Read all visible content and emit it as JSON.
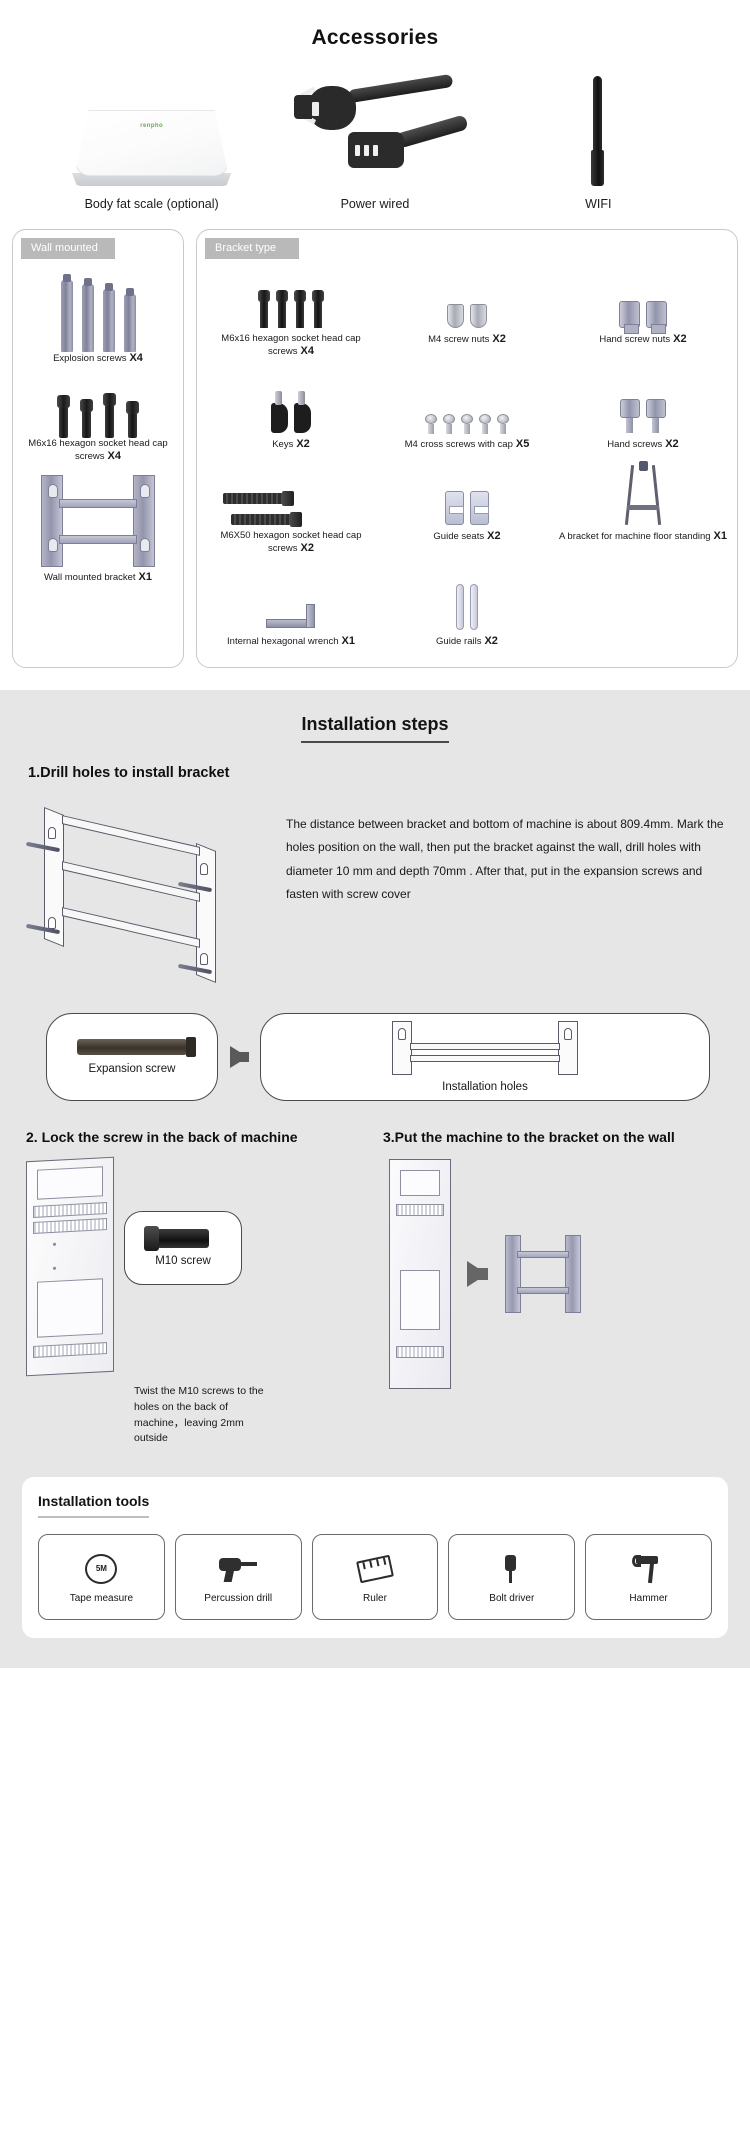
{
  "accessories": {
    "title": "Accessories",
    "items": [
      {
        "label": "Body fat scale (optional)",
        "icon": "body-fat-scale-icon",
        "brand": "renpho"
      },
      {
        "label": "Power wired",
        "icon": "power-cord-icon"
      },
      {
        "label": "WIFI",
        "icon": "wifi-antenna-icon"
      }
    ]
  },
  "panels": {
    "wall": {
      "badge": "Wall mounted",
      "parts": [
        {
          "name": "Explosion screws",
          "qty": "X4",
          "icon": "explosion-screws-icon"
        },
        {
          "name": "M6x16 hexagon socket head cap screws",
          "qty": "X4",
          "icon": "hex-cap-screws-icon"
        },
        {
          "name": "Wall mounted bracket",
          "qty": "X1",
          "icon": "wall-bracket-icon"
        }
      ]
    },
    "bracket": {
      "badge": "Bracket type",
      "parts": [
        {
          "name": "M6x16 hexagon socket head cap screws",
          "qty": "X4",
          "icon": "hex-cap-screws-icon"
        },
        {
          "name": "M4 screw nuts",
          "qty": "X2",
          "icon": "screw-nuts-icon"
        },
        {
          "name": "Hand screw nuts",
          "qty": "X2",
          "icon": "hand-screw-nuts-icon"
        },
        {
          "name": "Keys",
          "qty": "X2",
          "icon": "keys-icon"
        },
        {
          "name": "M4 cross screws with cap",
          "qty": "X5",
          "icon": "cross-screws-icon"
        },
        {
          "name": "Hand screws",
          "qty": "X2",
          "icon": "hand-screws-icon"
        },
        {
          "name": "M6X50 hexagon socket head cap screws",
          "qty": "X2",
          "icon": "long-hex-bolts-icon"
        },
        {
          "name": "Guide seats",
          "qty": "X2",
          "icon": "guide-seats-icon"
        },
        {
          "name": "Internal hexagonal wrench",
          "qty": "X1",
          "icon": "allen-wrench-icon"
        },
        {
          "name": "Guide rails",
          "qty": "X2",
          "icon": "guide-rails-icon"
        },
        {
          "name": "A bracket for machine floor standing",
          "qty": "X1",
          "icon": "floor-stand-bracket-icon"
        }
      ]
    }
  },
  "install": {
    "title": "Installation steps",
    "step1": {
      "heading": "1.Drill holes to install bracket",
      "text": "The distance between bracket and bottom of machine is about 809.4mm. Mark the holes position on the wall, then put the bracket against the wall, drill holes with diameter 10 mm and depth 70mm . After that, put in the expansion screws and fasten with screw cover",
      "callout_left": "Expansion screw",
      "callout_right": "Installation holes"
    },
    "step2": {
      "heading": "2. Lock the screw in the back of machine",
      "screw_label": "M10 screw",
      "note": "Twist the M10 screws to the holes on the back of machine，leaving 2mm outside"
    },
    "step3": {
      "heading": "3.Put the machine to the bracket on the wall"
    }
  },
  "tools": {
    "title": "Installation tools",
    "items": [
      {
        "label": "Tape measure",
        "icon": "tape-measure-icon",
        "face": "5M"
      },
      {
        "label": "Percussion drill",
        "icon": "drill-icon"
      },
      {
        "label": "Ruler",
        "icon": "ruler-icon"
      },
      {
        "label": "Bolt driver",
        "icon": "bolt-driver-icon"
      },
      {
        "label": "Hammer",
        "icon": "hammer-icon"
      }
    ]
  },
  "colors": {
    "badge_bg": "#b9b9b9",
    "section_bg": "#e6e6e6",
    "accent": "#4a4a4a"
  }
}
